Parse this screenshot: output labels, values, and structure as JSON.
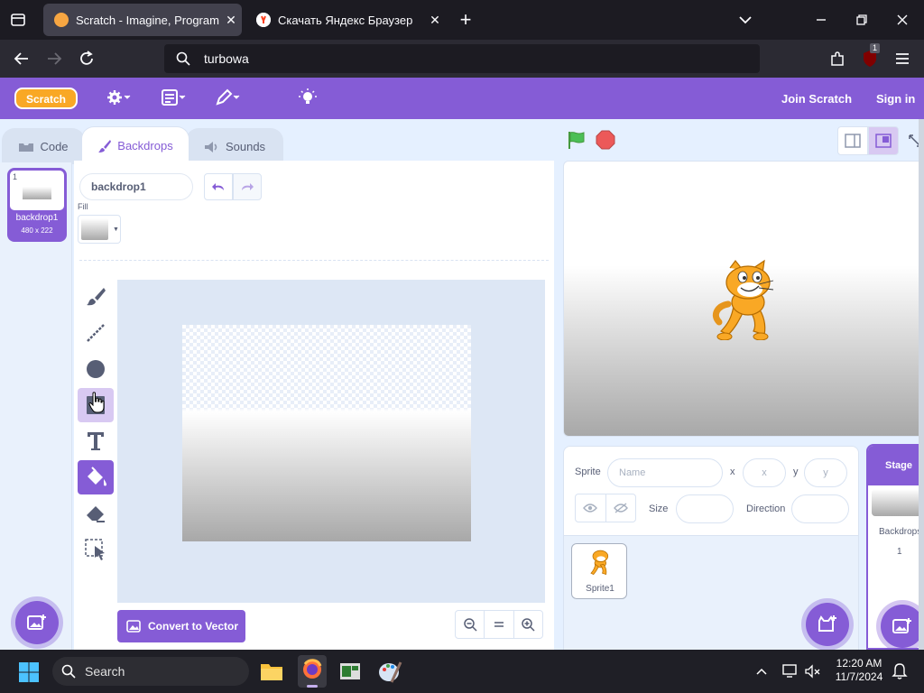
{
  "browser": {
    "tabs": [
      {
        "title": "Scratch - Imagine, Program, Share",
        "active": true
      },
      {
        "title": "Скачать Яндекс Браузер",
        "active": false
      }
    ],
    "url": "turbowa",
    "extension_badge": "1"
  },
  "scratch_header": {
    "logo": "Scratch",
    "join": "Join Scratch",
    "signin": "Sign in"
  },
  "editor_tabs": [
    {
      "label": "Code"
    },
    {
      "label": "Backdrops",
      "active": true
    },
    {
      "label": "Sounds"
    }
  ],
  "costume_list": [
    {
      "index": "1",
      "name": "backdrop1",
      "size": "480 x 222"
    }
  ],
  "paint_editor": {
    "costume_name": "backdrop1",
    "fill_label": "Fill",
    "convert_button": "Convert to Vector",
    "tools": [
      "brush",
      "line",
      "circle",
      "rectangle",
      "text",
      "fill",
      "eraser",
      "select"
    ],
    "selected_tool": "fill"
  },
  "sprite_info": {
    "sprite_label": "Sprite",
    "name_placeholder": "Name",
    "x_label": "x",
    "x_placeholder": "x",
    "y_label": "y",
    "y_placeholder": "y",
    "size_label": "Size",
    "direction_label": "Direction"
  },
  "sprites": [
    {
      "name": "Sprite1"
    }
  ],
  "stage_panel": {
    "title": "Stage",
    "backdrops_label": "Backdrops",
    "backdrops_count": "1"
  },
  "taskbar": {
    "search": "Search",
    "time": "12:20 AM",
    "date": "11/7/2024"
  },
  "colors": {
    "scratch_purple": "#855cd6",
    "background": "#e5f0ff",
    "green_flag": "#4cbf56",
    "stop": "#ec5959"
  }
}
